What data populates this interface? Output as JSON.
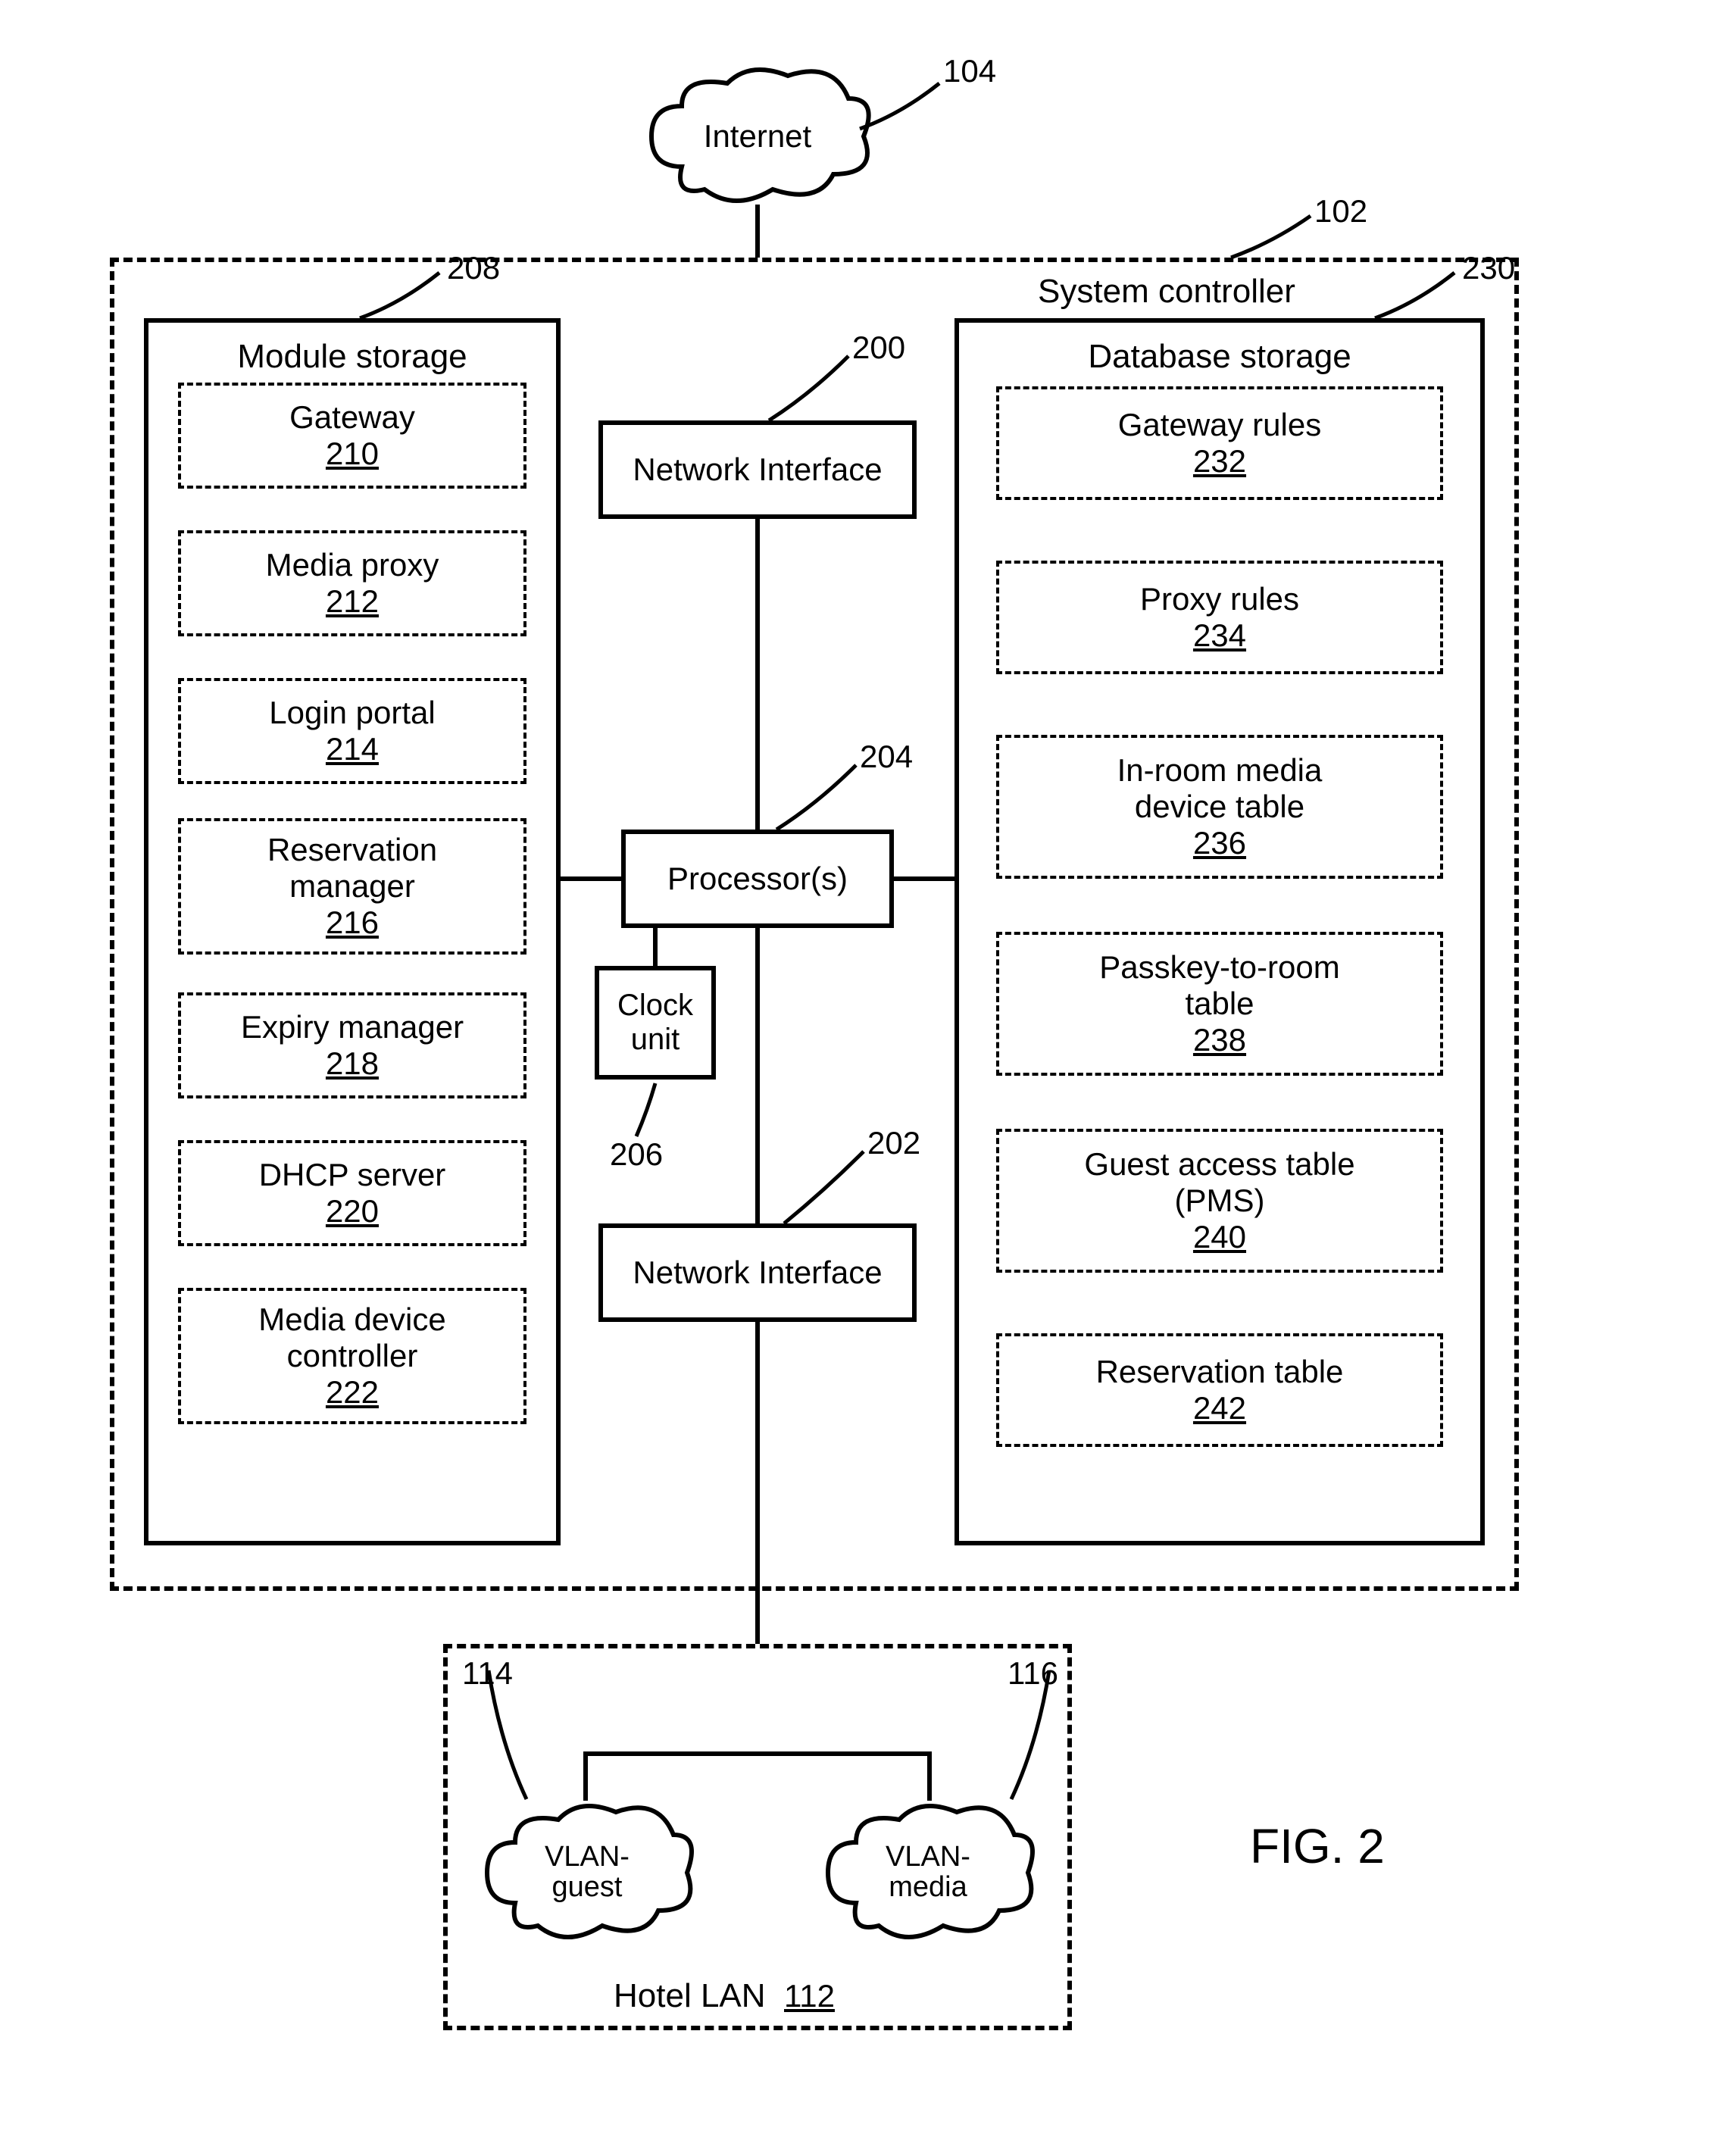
{
  "internet": {
    "label": "Internet",
    "ref": "104"
  },
  "system_controller": {
    "label": "System controller",
    "ref": "102"
  },
  "module_storage": {
    "title": "Module storage",
    "ref": "208",
    "items": [
      {
        "label": "Gateway",
        "ref": "210"
      },
      {
        "label": "Media proxy",
        "ref": "212"
      },
      {
        "label": "Login portal",
        "ref": "214"
      },
      {
        "label": "Reservation manager",
        "ref": "216"
      },
      {
        "label": "Expiry manager",
        "ref": "218"
      },
      {
        "label": "DHCP server",
        "ref": "220"
      },
      {
        "label": "Media device controller",
        "ref": "222"
      }
    ]
  },
  "database_storage": {
    "title": "Database storage",
    "ref": "230",
    "items": [
      {
        "label": "Gateway rules",
        "ref": "232"
      },
      {
        "label": "Proxy rules",
        "ref": "234"
      },
      {
        "label": "In-room media device table",
        "ref": "236"
      },
      {
        "label": "Passkey-to-room table",
        "ref": "238"
      },
      {
        "label": "Guest access table (PMS)",
        "ref": "240"
      },
      {
        "label": "Reservation table",
        "ref": "242"
      }
    ]
  },
  "center": {
    "network_interface_top": {
      "label": "Network Interface",
      "ref": "200"
    },
    "processors": {
      "label": "Processor(s)",
      "ref": "204"
    },
    "clock_unit": {
      "label": "Clock unit",
      "ref": "206"
    },
    "network_interface_bottom": {
      "label": "Network Interface",
      "ref": "202"
    }
  },
  "hotel_lan": {
    "label": "Hotel LAN",
    "ref": "112",
    "vlan_guest": {
      "label": "VLAN-guest",
      "ref": "114"
    },
    "vlan_media": {
      "label": "VLAN-media",
      "ref": "116"
    }
  },
  "figure_label": "FIG. 2"
}
